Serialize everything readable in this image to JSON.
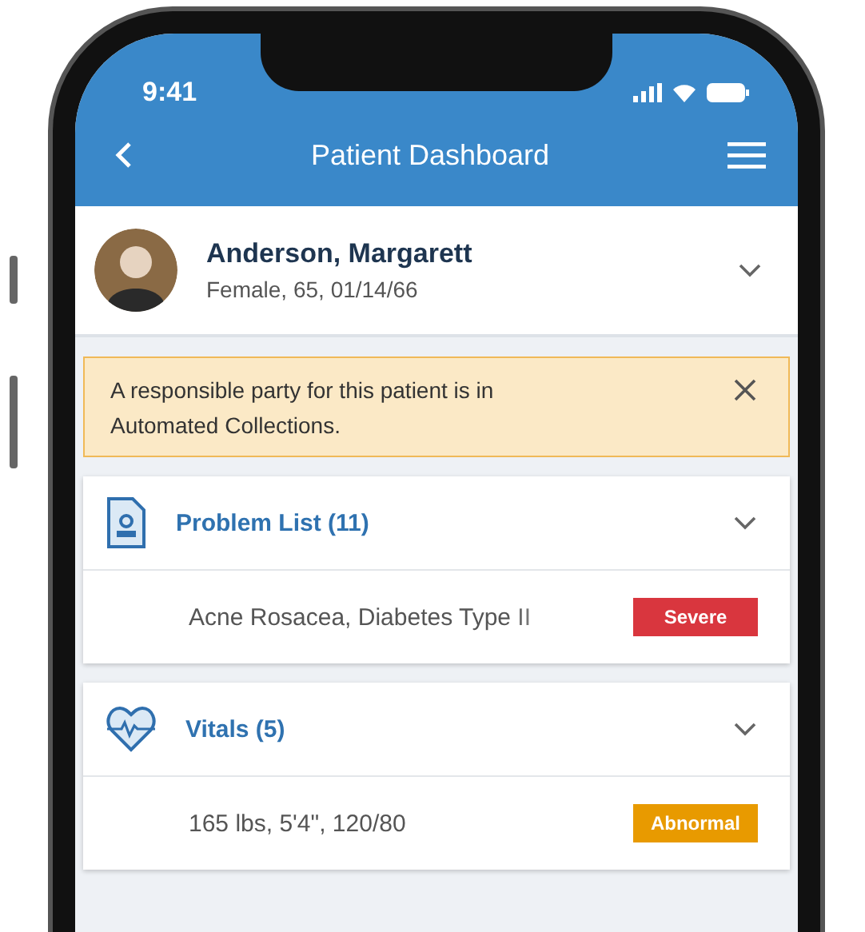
{
  "status_bar": {
    "time": "9:41"
  },
  "nav": {
    "title": "Patient Dashboard"
  },
  "patient": {
    "name": "Anderson, Margarett",
    "details": "Female, 65, 01/14/66",
    "expanded": false
  },
  "alert": {
    "message": "A responsible party for this patient is in Automated Collections."
  },
  "cards": [
    {
      "kind": "problems",
      "title": "Problem List (11)",
      "expanded": false,
      "summary": "Acne Rosacea, Diabetes Type II",
      "badge": {
        "label": "Severe",
        "color": "#d9363e"
      }
    },
    {
      "kind": "vitals",
      "title": "Vitals (5)",
      "expanded": false,
      "summary": "165 lbs, 5'4\", 120/80",
      "badge": {
        "label": "Abnormal",
        "color": "#e89a00"
      }
    }
  ]
}
